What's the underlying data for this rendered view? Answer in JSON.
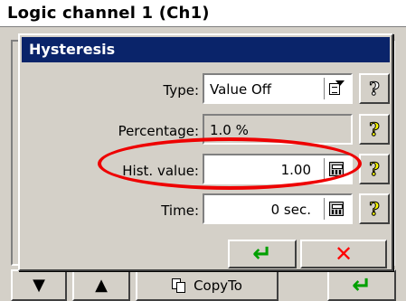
{
  "window": {
    "title": "Logic channel 1 (Ch1)"
  },
  "toolbar": {
    "down_glyph": "▼",
    "up_glyph": "▲",
    "copy_label": "CopyTo",
    "enter_glyph": "↵"
  },
  "dialog": {
    "title": "Hysteresis",
    "rows": {
      "type": {
        "label": "Type:",
        "value": "Value Off"
      },
      "percentage": {
        "label": "Percentage:",
        "value": "1.0 %"
      },
      "hist_value": {
        "label": "Hist. value:",
        "value": "1.00"
      },
      "time": {
        "label": "Time:",
        "value": "0 sec."
      }
    },
    "help_glyph": "?",
    "ok_glyph": "↵",
    "cancel_glyph": "✕"
  },
  "colors": {
    "titlebar": "#0a246a",
    "highlight": "#ee0000",
    "ok": "#00a000",
    "cancel": "#ff0000"
  }
}
